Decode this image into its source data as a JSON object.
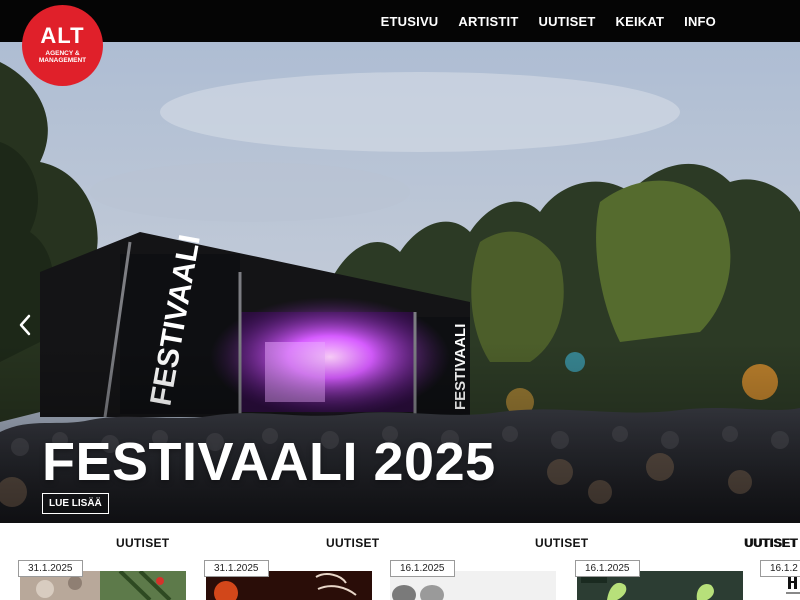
{
  "logo": {
    "main": "ALT",
    "sub_line1": "AGENCY &",
    "sub_line2": "MANAGEMENT"
  },
  "nav": {
    "items": [
      "ETUSIVU",
      "ARTISTIT",
      "UUTISET",
      "KEIKAT",
      "INFO"
    ]
  },
  "hero": {
    "title": "FESTIVAALI 2025",
    "read_more": "LUE LISÄÄ",
    "stage_banner_text": "FESTIVAALI"
  },
  "news": [
    {
      "heading": "UUTISET",
      "date": "31.1.2025",
      "icon": "nature-photo-thumbnail"
    },
    {
      "heading": "UUTISET",
      "date": "31.1.2025",
      "icon": "album-cover-thumbnail"
    },
    {
      "heading": "UUTISET",
      "date": "16.1.2025",
      "icon": "portrait-photo-thumbnail"
    },
    {
      "heading": "UUTISET",
      "date": "16.1.2025",
      "icon": "poster-thumbnail"
    },
    {
      "heading": "UUTISET",
      "date": "16.1.2",
      "icon": "text-thumbnail"
    }
  ],
  "colors": {
    "brand_red": "#e0202a",
    "topbar": "#050505",
    "stage_light": "#c64bff"
  }
}
